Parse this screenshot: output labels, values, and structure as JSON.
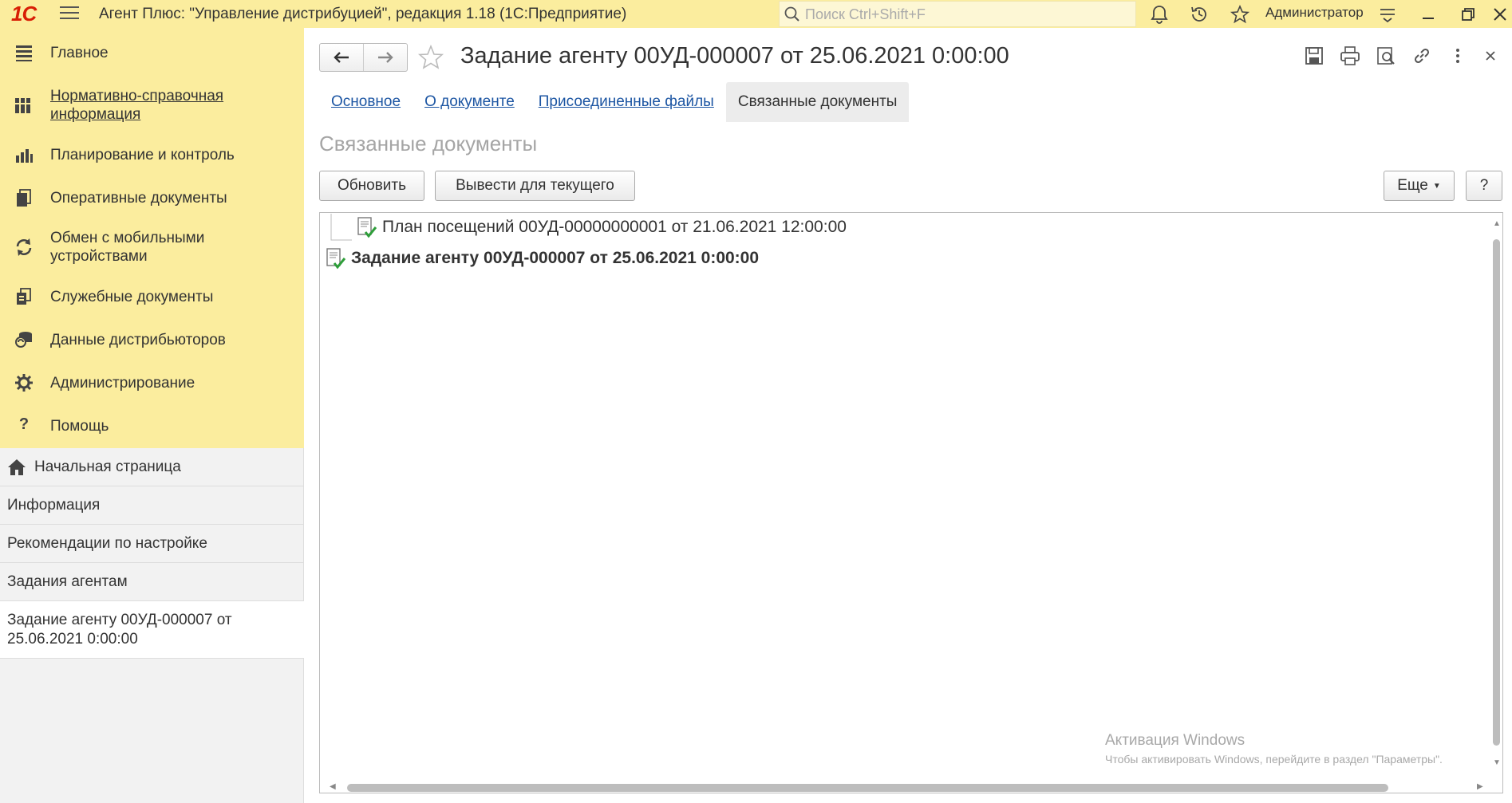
{
  "app": {
    "title": "Агент Плюс: \"Управление дистрибуцией\", редакция 1.18  (1С:Предприятие)",
    "logo": "1С",
    "search_placeholder": "Поиск Ctrl+Shift+F",
    "user": "Администратор"
  },
  "sections": [
    {
      "label": "Главное",
      "icon": "list-icon"
    },
    {
      "label": "Нормативно-справочная информация",
      "icon": "books-icon",
      "link": true
    },
    {
      "label": "Планирование и контроль",
      "icon": "chart-icon"
    },
    {
      "label": "Оперативные документы",
      "icon": "documents-icon"
    },
    {
      "label": "Обмен с мобильными устройствами",
      "icon": "sync-icon"
    },
    {
      "label": "Служебные документы",
      "icon": "service-docs-icon"
    },
    {
      "label": "Данные дистрибьюторов",
      "icon": "distributors-icon"
    },
    {
      "label": "Администрирование",
      "icon": "gear-icon"
    },
    {
      "label": "Помощь",
      "icon": "help-icon"
    }
  ],
  "nav_items": [
    {
      "label": "Начальная страница",
      "icon": "home-icon"
    },
    {
      "label": "Информация"
    },
    {
      "label": "Рекомендации по настройке"
    },
    {
      "label": "Задания агентам"
    },
    {
      "label": "Задание агенту 00УД-000007 от 25.06.2021 0:00:00",
      "active": true
    }
  ],
  "document": {
    "title": "Задание агенту 00УД-000007 от 25.06.2021 0:00:00",
    "tabs": [
      {
        "label": "Основное"
      },
      {
        "label": "О документе"
      },
      {
        "label": "Присоединенные файлы"
      },
      {
        "label": "Связанные документы",
        "active": true
      }
    ],
    "section_title": "Связанные документы",
    "buttons": {
      "refresh": "Обновить",
      "show_current": "Вывести для текущего",
      "more": "Еще",
      "help": "?"
    },
    "rows": [
      {
        "text": "План посещений 00УД-00000000001 от 21.06.2021 12:00:00",
        "bold": false
      },
      {
        "text": "Задание агенту 00УД-000007 от 25.06.2021 0:00:00",
        "bold": true
      }
    ]
  },
  "watermark": {
    "line1": "Активация Windows",
    "line2": "Чтобы активировать Windows, перейдите в раздел \"Параметры\"."
  },
  "colors": {
    "topbar": "#fbed9e",
    "link": "#1d56a3",
    "logo": "#d81e05",
    "check": "#2e9e3a"
  }
}
